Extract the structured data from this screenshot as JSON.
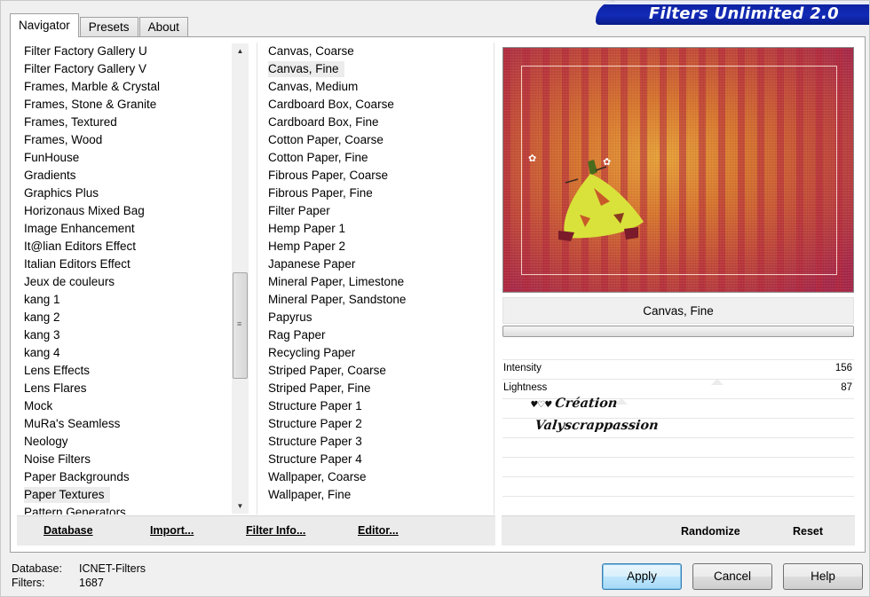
{
  "app": {
    "title": "Filters Unlimited 2.0"
  },
  "tabs": [
    {
      "label": "Navigator",
      "active": true
    },
    {
      "label": "Presets",
      "active": false
    },
    {
      "label": "About",
      "active": false
    }
  ],
  "categories": {
    "items": [
      "Filter Factory Gallery U",
      "Filter Factory Gallery V",
      "Frames, Marble & Crystal",
      "Frames, Stone & Granite",
      "Frames, Textured",
      "Frames, Wood",
      "FunHouse",
      "Gradients",
      "Graphics Plus",
      "Horizonaus Mixed Bag",
      "Image Enhancement",
      "It@lian Editors Effect",
      "Italian Editors Effect",
      "Jeux de couleurs",
      "kang 1",
      "kang 2",
      "kang 3",
      "kang 4",
      "Lens Effects",
      "Lens Flares",
      "Mock",
      "MuRa's Seamless",
      "Neology",
      "Noise Filters",
      "Paper Backgrounds",
      "Paper Textures",
      "Pattern Generators"
    ],
    "selected": "Paper Textures"
  },
  "filters": {
    "items": [
      "Canvas, Coarse",
      "Canvas, Fine",
      "Canvas, Medium",
      "Cardboard Box, Coarse",
      "Cardboard Box, Fine",
      "Cotton Paper, Coarse",
      "Cotton Paper, Fine",
      "Fibrous Paper, Coarse",
      "Fibrous Paper, Fine",
      "Filter Paper",
      "Hemp Paper 1",
      "Hemp Paper 2",
      "Japanese Paper",
      "Mineral Paper, Limestone",
      "Mineral Paper, Sandstone",
      "Papyrus",
      "Rag Paper",
      "Recycling Paper",
      "Striped Paper, Coarse",
      "Striped Paper, Fine",
      "Structure Paper 1",
      "Structure Paper 2",
      "Structure Paper 3",
      "Structure Paper 4",
      "Wallpaper, Coarse",
      "Wallpaper, Fine"
    ],
    "selected": "Canvas, Fine"
  },
  "left_toolbar": {
    "database": "Database",
    "import": "Import...",
    "filter_info": "Filter Info...",
    "editor": "Editor..."
  },
  "preview": {
    "filter_name": "Canvas, Fine"
  },
  "params": [
    {
      "label": "Intensity",
      "value": "156",
      "level": 0.61
    },
    {
      "label": "Lightness",
      "value": "87",
      "level": 0.34
    }
  ],
  "watermark": {
    "hearts": "♥♡♥",
    "line1": "Création",
    "line2": "Valyscrappassion"
  },
  "right_toolbar": {
    "randomize": "Randomize",
    "reset": "Reset"
  },
  "status": {
    "database_label": "Database:",
    "database_value": "ICNET-Filters",
    "filters_label": "Filters:",
    "filters_value": "1687"
  },
  "buttons": {
    "apply": "Apply",
    "cancel": "Cancel",
    "help": "Help"
  },
  "colors": {
    "banner": "#122bb8",
    "accent": "#3c7fb1"
  }
}
